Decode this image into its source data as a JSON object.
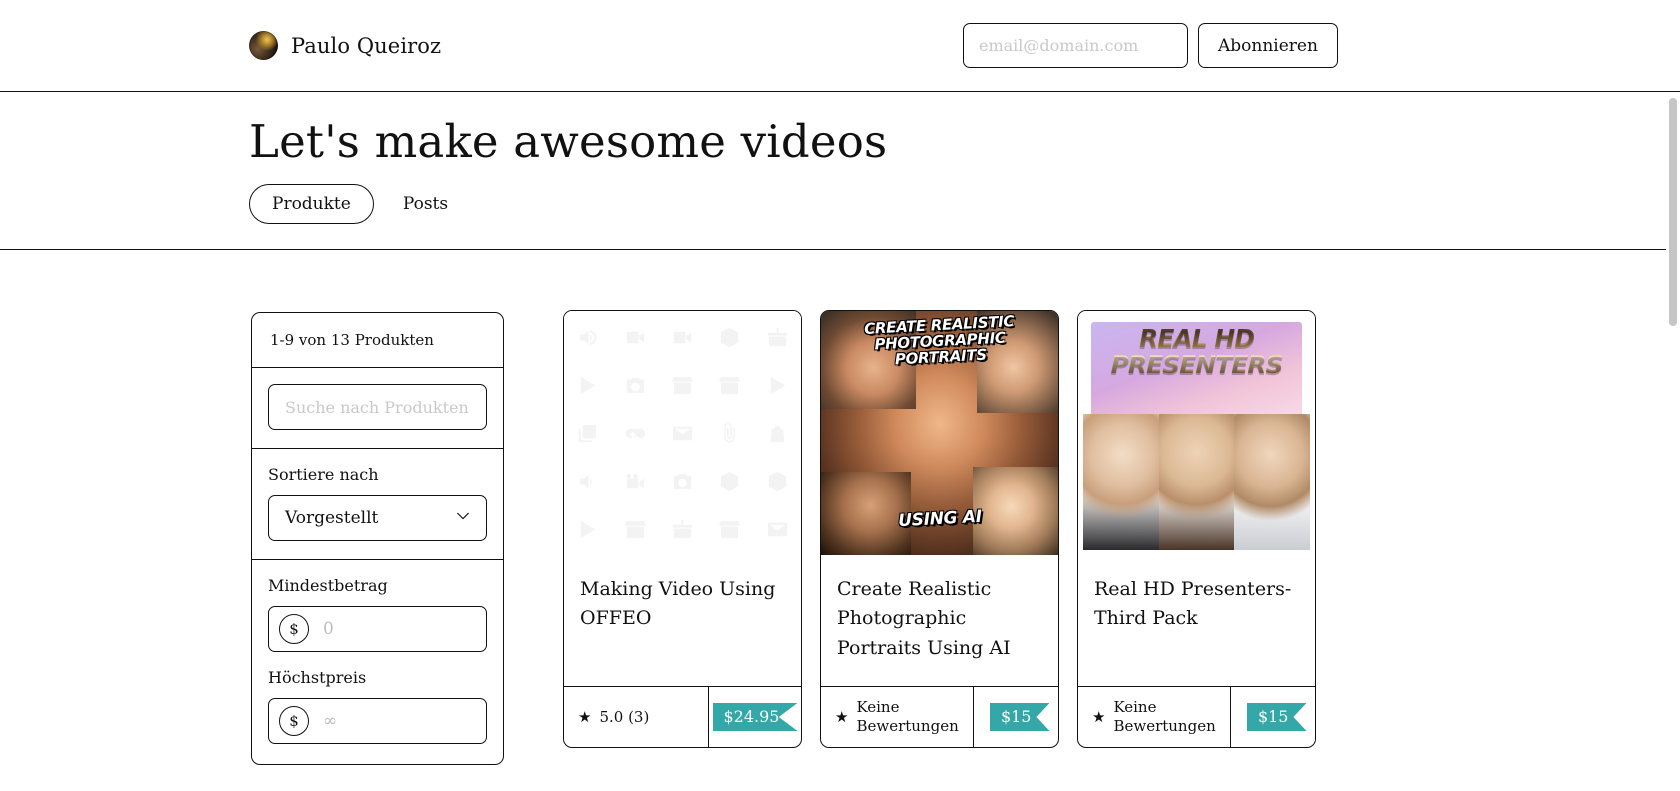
{
  "header": {
    "brand_name": "Paulo Queiroz",
    "avatar_icon": "user-avatar",
    "email_placeholder": "email@domain.com",
    "email_value": "",
    "subscribe_label": "Abonnieren"
  },
  "hero": {
    "title": "Let's make awesome videos",
    "tabs": [
      {
        "label": "Produkte",
        "active": true
      },
      {
        "label": "Posts",
        "active": false
      }
    ]
  },
  "filters": {
    "count_text": "1-9 von 13 Produkten",
    "search_placeholder": "Suche nach Produkten ...",
    "search_value": "",
    "sort_label": "Sortiere nach",
    "sort_value": "Vorgestellt",
    "sort_icon": "chevron-down-icon",
    "min_label": "Mindestbetrag",
    "min_currency": "$",
    "min_placeholder": "0",
    "min_value": "",
    "max_label": "Höchstpreis",
    "max_currency": "$",
    "max_placeholder": "∞",
    "max_value": ""
  },
  "products": [
    {
      "title": "Making Video Using OFFEO",
      "rating_icon": "star-icon",
      "rating_text": "5.0 (3)",
      "price": "$24.95",
      "media": "placeholder-icon-grid"
    },
    {
      "title": "Create Realistic Photographic Portraits Using AI",
      "rating_icon": "star-icon",
      "rating_text": "Keine Bewertungen",
      "price": "$15",
      "media": "photo-collage",
      "media_caption_top": "CREATE REALISTIC PHOTOGRAPHIC PORTRAITS",
      "media_caption_bottom": "USING AI"
    },
    {
      "title": "Real HD Presenters-Third Pack",
      "rating_icon": "star-icon",
      "rating_text": "Keine Bewertungen",
      "price": "$15",
      "media": "presenters-photo",
      "media_caption_top": "REAL HD PRESENTERS"
    }
  ],
  "colors": {
    "price_tag": "#34a7a8",
    "border": "#111111",
    "placeholder_text": "#c9c9c9",
    "scrollbar_thumb": "#c6c6c6"
  }
}
